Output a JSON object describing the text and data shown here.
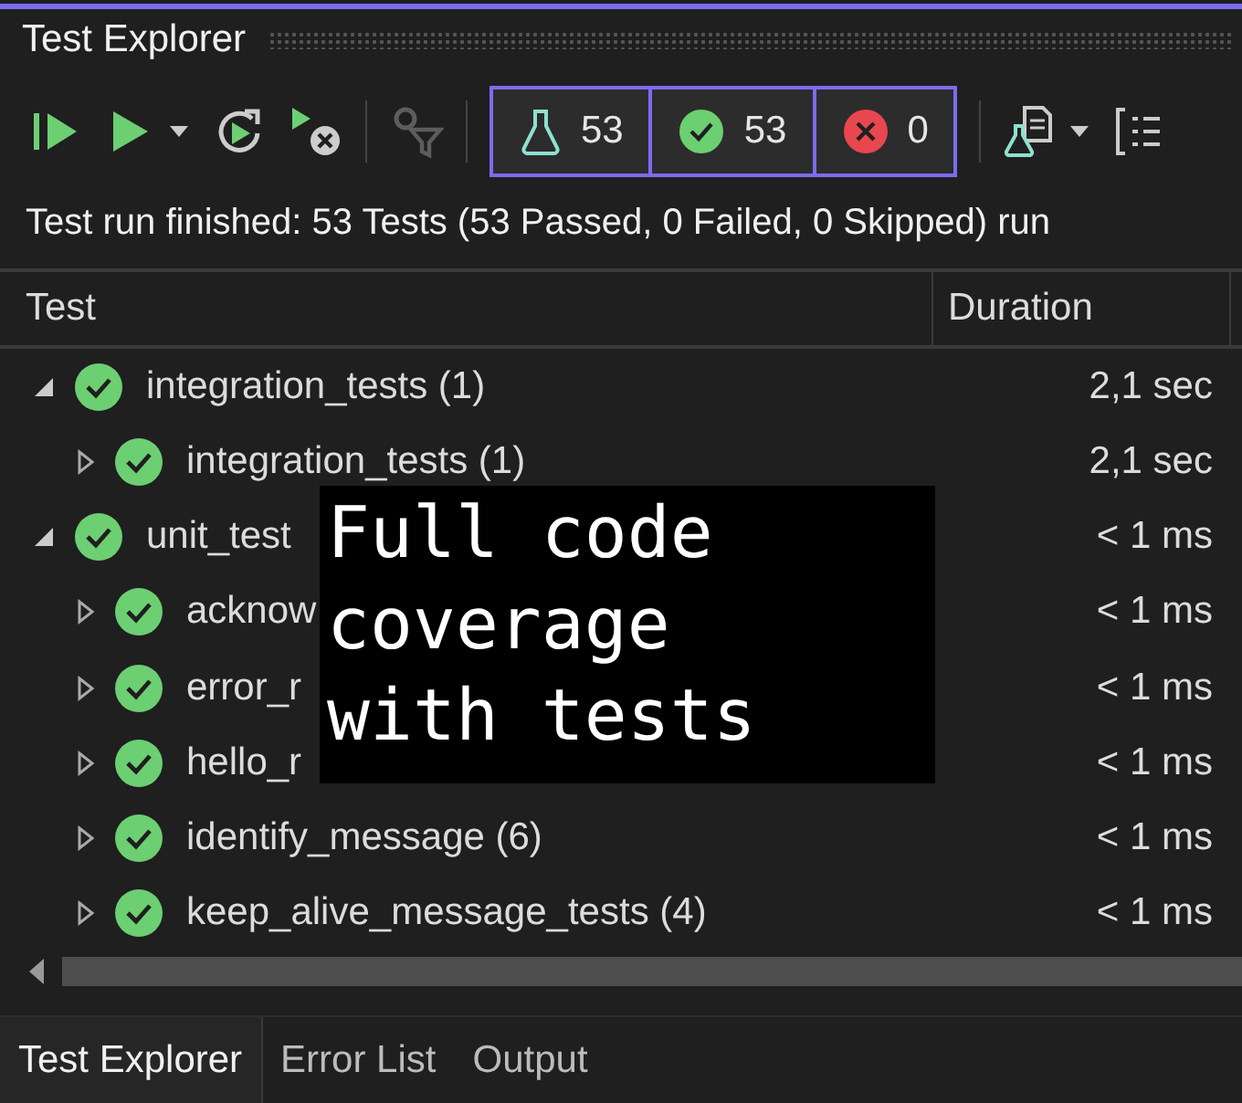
{
  "window": {
    "title": "Test Explorer"
  },
  "toolbar": {
    "counters": [
      {
        "kind": "total",
        "value": "53"
      },
      {
        "kind": "passed",
        "value": "53"
      },
      {
        "kind": "failed",
        "value": "0"
      }
    ],
    "filter_disabled": true
  },
  "status_message": "Test run finished: 53 Tests (53 Passed, 0 Failed, 0 Skipped) run",
  "table": {
    "columns": [
      "Test",
      "Duration"
    ],
    "rows": [
      {
        "name": "integration_tests (1)",
        "duration": "2,1 sec",
        "expanded": true,
        "children": [
          {
            "name": "integration_tests (1)",
            "duration": "2,1 sec",
            "expanded": false
          }
        ]
      },
      {
        "name": "unit_test",
        "duration": "< 1 ms",
        "expanded": true,
        "children": [
          {
            "name": "acknow",
            "duration": "< 1 ms",
            "expanded": false
          },
          {
            "name": "error_r",
            "duration": "< 1 ms",
            "expanded": false
          },
          {
            "name": "hello_r",
            "duration": "< 1 ms",
            "expanded": false
          },
          {
            "name": "identify_message (6)",
            "duration": "< 1 ms",
            "expanded": false
          },
          {
            "name": "keep_alive_message_tests (4)",
            "duration": "< 1 ms",
            "expanded": false
          }
        ]
      }
    ]
  },
  "caption": {
    "lines": [
      "Full code",
      "coverage",
      "with tests"
    ]
  },
  "bottom_tabs": [
    {
      "label": "Test Explorer",
      "selected": true
    },
    {
      "label": "Error List",
      "selected": false
    },
    {
      "label": "Output",
      "selected": false
    }
  ]
}
